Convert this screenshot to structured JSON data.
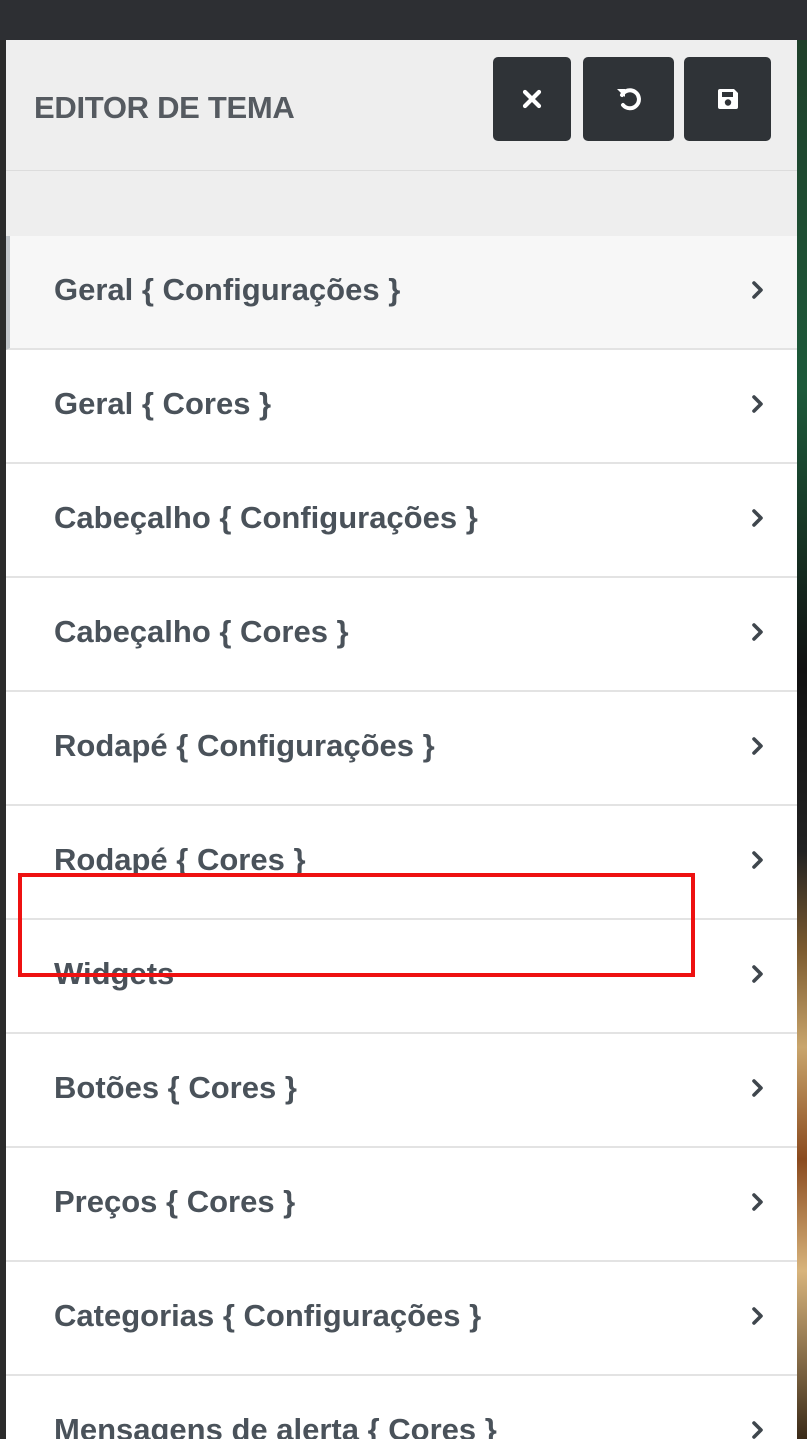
{
  "header": {
    "title": "EDITOR DE TEMA",
    "buttons": [
      {
        "icon": "close-icon"
      },
      {
        "icon": "undo-icon"
      },
      {
        "icon": "save-icon"
      }
    ]
  },
  "menu": {
    "items": [
      {
        "label": "Geral { Configurações }",
        "active": true
      },
      {
        "label": "Geral { Cores }"
      },
      {
        "label": "Cabeçalho { Configurações }"
      },
      {
        "label": "Cabeçalho { Cores }"
      },
      {
        "label": "Rodapé { Configurações }"
      },
      {
        "label": "Rodapé { Cores }"
      },
      {
        "label": "Widgets",
        "highlighted": true
      },
      {
        "label": "Botões { Cores }"
      },
      {
        "label": "Preços { Cores }"
      },
      {
        "label": "Categorias { Configurações }"
      },
      {
        "label": "Mensagens de alerta { Cores }"
      }
    ]
  },
  "colors": {
    "header_bg": "#eeeeee",
    "button_bg": "#2f3337",
    "text": "#4a525a",
    "highlight": "#ee1111"
  }
}
